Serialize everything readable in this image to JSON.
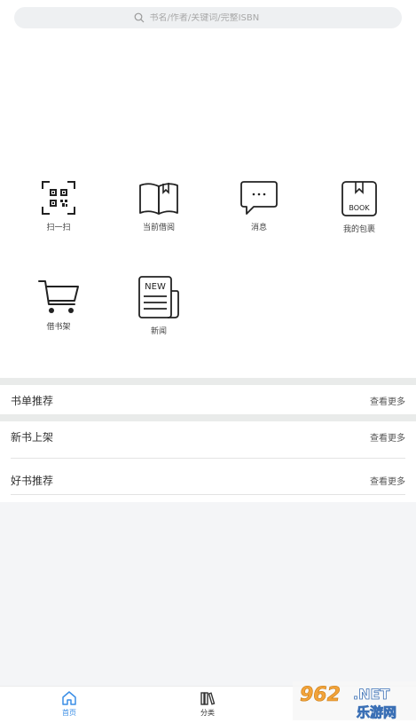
{
  "search": {
    "placeholder": "书名/作者/关键词/完整ISBN"
  },
  "grid": {
    "items": [
      {
        "label": "扫一扫",
        "icon": "qr-scan-icon"
      },
      {
        "label": "当前借阅",
        "icon": "open-book-icon"
      },
      {
        "label": "消息",
        "icon": "message-icon"
      },
      {
        "label": "我的包裹",
        "icon": "book-package-icon"
      },
      {
        "label": "借书架",
        "icon": "cart-icon"
      },
      {
        "label": "新闻",
        "icon": "newspaper-icon"
      }
    ],
    "package_icon_text": "BOOK",
    "news_icon_text": "NEW",
    "message_icon_text": "···"
  },
  "sections": [
    {
      "title": "书单推荐",
      "more": "查看更多"
    },
    {
      "title": "新书上架",
      "more": "查看更多"
    },
    {
      "title": "好书推荐",
      "more": "查看更多"
    }
  ],
  "tabbar": {
    "tabs": [
      {
        "label": "首页",
        "icon": "home-icon",
        "active": true
      },
      {
        "label": "分类",
        "icon": "books-icon",
        "active": false
      }
    ],
    "active_color": "#3a8ee6"
  },
  "watermark": {
    "text_top": "962.NET",
    "text_bottom": "乐游网"
  }
}
